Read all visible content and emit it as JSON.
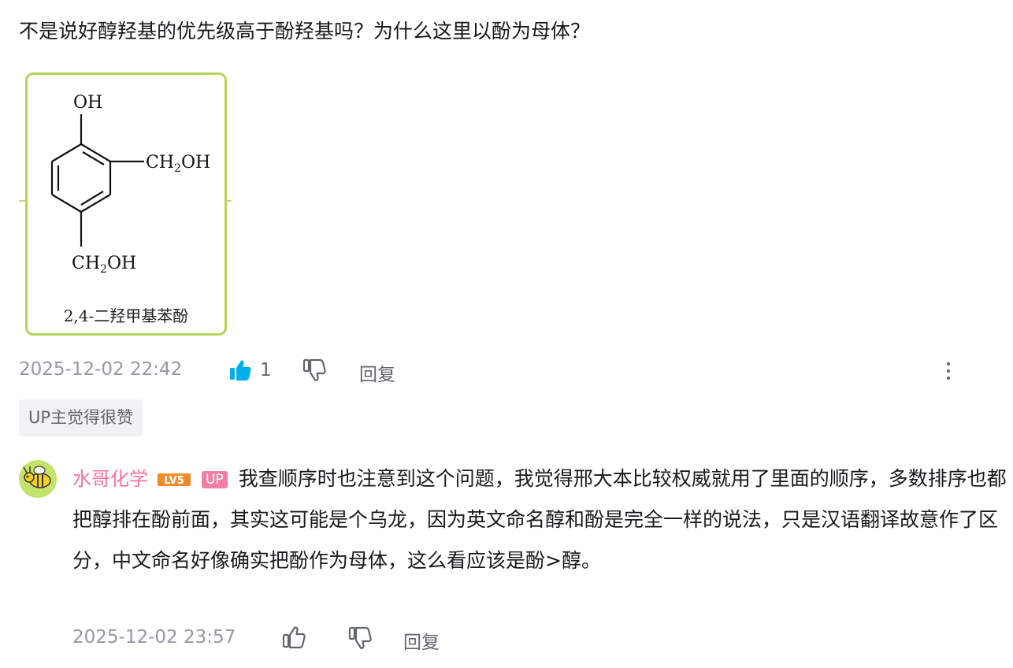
{
  "comment": {
    "question": "不是说好醇羟基的优先级高于酚羟基吗？为什么这里以酚为母体？",
    "figure": {
      "caption": "2,4-二羟甲基苯酚",
      "oh_label": "OH",
      "ch2oh_label": "CH",
      "ch2oh_sub": "2",
      "oh_suffix": "OH"
    },
    "time": "2025-12-02 22:42",
    "like_count": "1",
    "reply_label": "回复",
    "up_liked_badge": "UP主觉得很赞"
  },
  "reply": {
    "username": "水哥化学",
    "level": "LV5",
    "up_tag": "UP",
    "text": "我查顺序时也注意到这个问题，我觉得邢大本比较权威就用了里面的顺序，多数排序也都把醇排在酚前面，其实这可能是个乌龙，因为英文命名醇和酚是完全一样的说法，只是汉语翻译故意作了区分，中文命名好像确实把酚作为母体，这么看应该是酚>醇。",
    "time": "2025-12-02 23:57",
    "reply_label": "回复"
  },
  "colors": {
    "username": "#fb7299",
    "level_badge": "#f28b2c",
    "up_tag": "#f07fa2",
    "like_active": "#00aeec",
    "meta_text": "#9499a0",
    "card_border": "#b9d25a"
  },
  "icons": {
    "like_active": "thumbs-up-filled-icon",
    "dislike": "thumbs-down-outline-icon",
    "like": "thumbs-up-outline-icon",
    "more": "more-vertical-icon",
    "avatar": "bee-avatar-icon"
  }
}
